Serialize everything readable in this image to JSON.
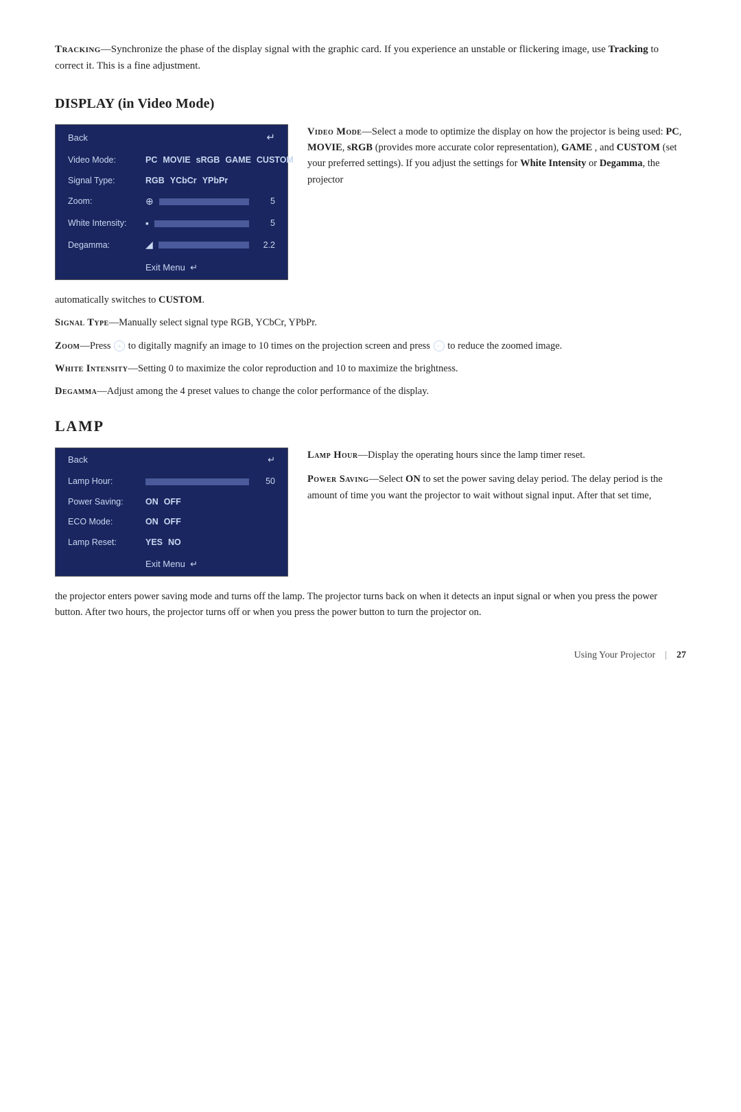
{
  "intro": {
    "term": "Tracking",
    "text1": "—Synchronize the phase of the display signal with the graphic card. If you experience an unstable or flickering image, use ",
    "term_inline": "Tracking",
    "text2": " to correct it. This is a fine adjustment."
  },
  "display_section": {
    "heading": "DISPLAY (in Video Mode)",
    "menu": {
      "back_label": "Back",
      "enter_symbol": "↵",
      "rows": [
        {
          "type": "options",
          "label": "Video Mode:",
          "options": [
            "PC",
            "MOVIE",
            "sRGB",
            "GAME",
            "CUSTOM"
          ]
        },
        {
          "type": "options",
          "label": "Signal Type:",
          "options": [
            "RGB",
            "YCbCr",
            "YPbPr"
          ]
        },
        {
          "type": "slider",
          "label": "Zoom:",
          "icon": "⊕",
          "value": "5"
        },
        {
          "type": "slider",
          "label": "White Intensity:",
          "icon": "▪",
          "value": "5"
        },
        {
          "type": "slider",
          "label": "Degamma:",
          "icon": "◥",
          "value": "2.2"
        },
        {
          "type": "footer",
          "label": "Exit Menu",
          "symbol": "↵"
        }
      ]
    },
    "side_description": {
      "term": "Video Mode",
      "dash": "—",
      "text1": "Select a mode to optimize the display on how the projector is being used: ",
      "pc": "PC",
      "movie": "MOVIE",
      "srgb": "sRGB",
      "text2": " (provides more accurate color representation), ",
      "game": "GAME",
      "text3": " , and ",
      "custom": "CUSTOM",
      "text4": " (set your preferred settings). If you adjust the settings for ",
      "white_intensity": "White Intensity",
      "text5": " or ",
      "degamma": "Degamma",
      "text6": ", the projector"
    }
  },
  "display_body": [
    {
      "id": "auto_switch",
      "text": "automatically switches to ",
      "bold": "CUSTOM",
      "text2": "."
    },
    {
      "id": "signal_type",
      "term": "Signal Type",
      "dash": "—",
      "text": "Manually select signal type RGB, YCbCr, YPbPr."
    },
    {
      "id": "zoom",
      "term": "Zoom",
      "dash": "—",
      "text1": "Press ",
      "plus": "+",
      "text2": " to digitally magnify an image to 10 times on the projection screen and press ",
      "minus": "−",
      "text3": " to reduce the zoomed image."
    },
    {
      "id": "white_intensity",
      "term": "White Intensity",
      "dash": "—",
      "text": "Setting 0 to maximize the color reproduction and 10 to maximize the brightness."
    },
    {
      "id": "degamma",
      "term": "Degamma",
      "dash": "—",
      "text": "Adjust among the 4 preset values to change the color performance of the display."
    }
  ],
  "lamp_section": {
    "heading": "LAMP",
    "menu": {
      "back_label": "Back",
      "enter_symbol": "↵",
      "rows": [
        {
          "type": "slider",
          "label": "Lamp Hour:",
          "value": "50"
        },
        {
          "type": "options",
          "label": "Power Saving:",
          "options": [
            "ON",
            "OFF"
          ]
        },
        {
          "type": "options",
          "label": "ECO Mode:",
          "options": [
            "ON",
            "OFF"
          ]
        },
        {
          "type": "options",
          "label": "Lamp Reset:",
          "options": [
            "YES",
            "NO"
          ]
        },
        {
          "type": "footer",
          "label": "Exit Menu",
          "symbol": "↵"
        }
      ]
    },
    "side_description": {
      "lamp_hour_term": "Lamp Hour",
      "lamp_hour_dash": "—",
      "lamp_hour_text": "Display the operating hours since the lamp timer reset.",
      "power_saving_term": "Power Saving",
      "power_saving_dash": "—",
      "power_saving_text1": "Select ",
      "power_saving_on": "ON",
      "power_saving_text2": " to set the power saving delay period. The delay period is the amount of time you want the projector to wait without signal input. After that set time,"
    }
  },
  "lamp_body": {
    "text": "the projector enters power saving mode and turns off the lamp. The projector turns back on when it detects an input signal or when you press the power button. After two hours, the projector turns off or when you press the power button to turn the projector on."
  },
  "footer": {
    "page_title": "Using Your Projector",
    "separator": "|",
    "page_number": "27"
  }
}
